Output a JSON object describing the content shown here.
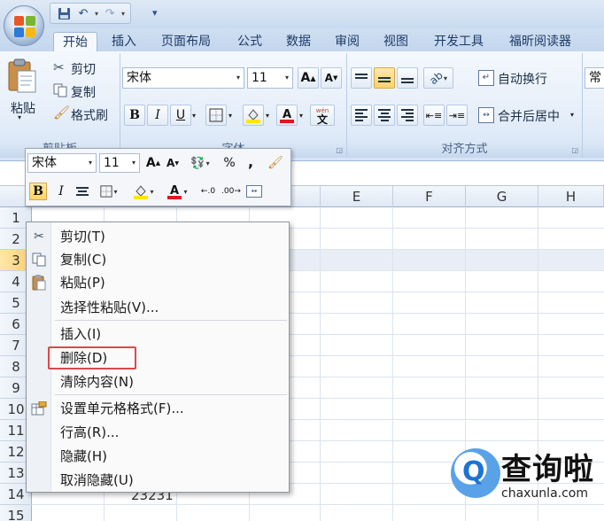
{
  "quick_access": {
    "undo_icon": "undo-icon",
    "redo_icon": "redo-icon",
    "save_icon": "save-icon"
  },
  "tabs": [
    {
      "label": "开始",
      "active": true
    },
    {
      "label": "插入"
    },
    {
      "label": "页面布局"
    },
    {
      "label": "公式"
    },
    {
      "label": "数据"
    },
    {
      "label": "审阅"
    },
    {
      "label": "视图"
    },
    {
      "label": "开发工具"
    },
    {
      "label": "福昕阅读器"
    }
  ],
  "ribbon": {
    "clipboard": {
      "paste": "粘贴",
      "cut": "剪切",
      "copy": "复制",
      "format_painter": "格式刷",
      "label": "剪贴板"
    },
    "font": {
      "font_name": "宋体",
      "font_size": "11",
      "grow": "A",
      "shrink": "A",
      "bold": "B",
      "italic": "I",
      "underline": "U",
      "phonetic": "wén",
      "label": "字体"
    },
    "alignment": {
      "wrap": "自动换行",
      "merge": "合并后居中",
      "label": "对齐方式"
    },
    "number": {
      "format": "常"
    }
  },
  "minibar": {
    "font_name": "宋体",
    "font_size": "11",
    "percent": "%",
    "comma": ",",
    "bold": "B",
    "italic": "I"
  },
  "columns": [
    "E",
    "F",
    "G",
    "H"
  ],
  "rows": [
    "1",
    "2",
    "3",
    "4",
    "5",
    "6",
    "7",
    "8",
    "9",
    "10",
    "11",
    "12",
    "13",
    "14",
    "15"
  ],
  "selected_row": "3",
  "cell_value": "23231",
  "context_menu": [
    {
      "label": "剪切(T)",
      "icon": "scissors-icon"
    },
    {
      "label": "复制(C)",
      "icon": "copy-icon"
    },
    {
      "label": "粘贴(P)",
      "icon": "paste-icon"
    },
    {
      "label": "选择性粘贴(V)..."
    },
    {
      "label": "插入(I)"
    },
    {
      "label": "删除(D)",
      "highlighted": true
    },
    {
      "label": "清除内容(N)"
    },
    {
      "label": "设置单元格格式(F)...",
      "icon": "format-cells-icon"
    },
    {
      "label": "行高(R)..."
    },
    {
      "label": "隐藏(H)"
    },
    {
      "label": "取消隐藏(U)"
    }
  ],
  "watermark": {
    "cn": "查询啦",
    "en": "chaxunla.com",
    "q": "Q"
  },
  "colors": {
    "highlight_box": "#d84a4a",
    "ribbon_bg": "#e5eef9",
    "selected_row_header": "#f9cf72"
  }
}
